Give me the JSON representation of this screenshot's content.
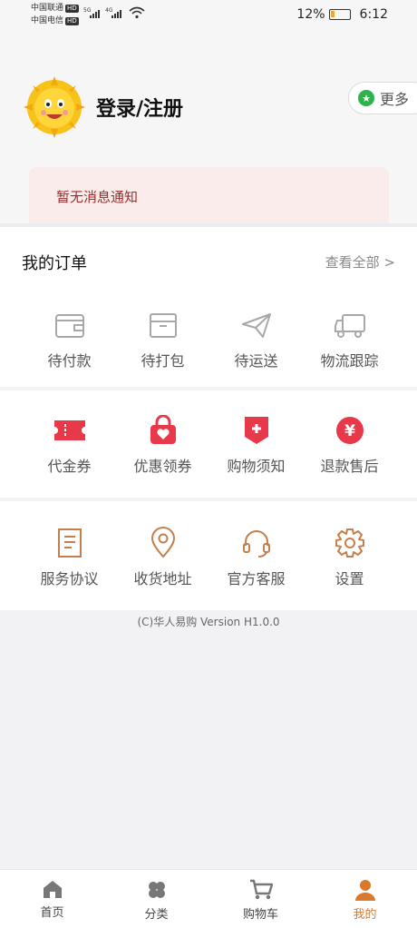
{
  "status_bar": {
    "carrier1": "中国联通",
    "carrier2": "中国电信",
    "hd": "HD",
    "net1": "5G",
    "net2": "4G",
    "battery": "12%",
    "time": "6:12"
  },
  "header": {
    "login_text": "登录/注册",
    "more_label": "更多",
    "notice": "暂无消息通知"
  },
  "orders": {
    "title": "我的订单",
    "view_all": "查看全部 >",
    "items": [
      {
        "label": "待付款",
        "icon": "wallet-icon"
      },
      {
        "label": "待打包",
        "icon": "box-icon"
      },
      {
        "label": "待运送",
        "icon": "paper-plane-icon"
      },
      {
        "label": "物流跟踪",
        "icon": "truck-icon"
      }
    ]
  },
  "promos": {
    "items": [
      {
        "label": "代金券",
        "icon": "ticket-icon"
      },
      {
        "label": "优惠领券",
        "icon": "bag-heart-icon"
      },
      {
        "label": "购物须知",
        "icon": "shield-plus-icon"
      },
      {
        "label": "退款售后",
        "icon": "yen-circle-icon"
      }
    ]
  },
  "services": {
    "items": [
      {
        "label": "服务协议",
        "icon": "document-icon"
      },
      {
        "label": "收货地址",
        "icon": "location-pin-icon"
      },
      {
        "label": "官方客服",
        "icon": "headset-icon"
      },
      {
        "label": "设置",
        "icon": "gear-icon"
      }
    ]
  },
  "version": "(C)华人易购 Version H1.0.0",
  "tabbar": {
    "items": [
      {
        "label": "首页",
        "icon": "home-icon"
      },
      {
        "label": "分类",
        "icon": "category-icon"
      },
      {
        "label": "购物车",
        "icon": "cart-icon"
      },
      {
        "label": "我的",
        "icon": "user-icon",
        "active": true
      }
    ]
  },
  "colors": {
    "accent": "#d9792c",
    "promo_red": "#e8394a",
    "notice_bg": "#fbecec",
    "icon_gray": "#a8a8a8"
  }
}
